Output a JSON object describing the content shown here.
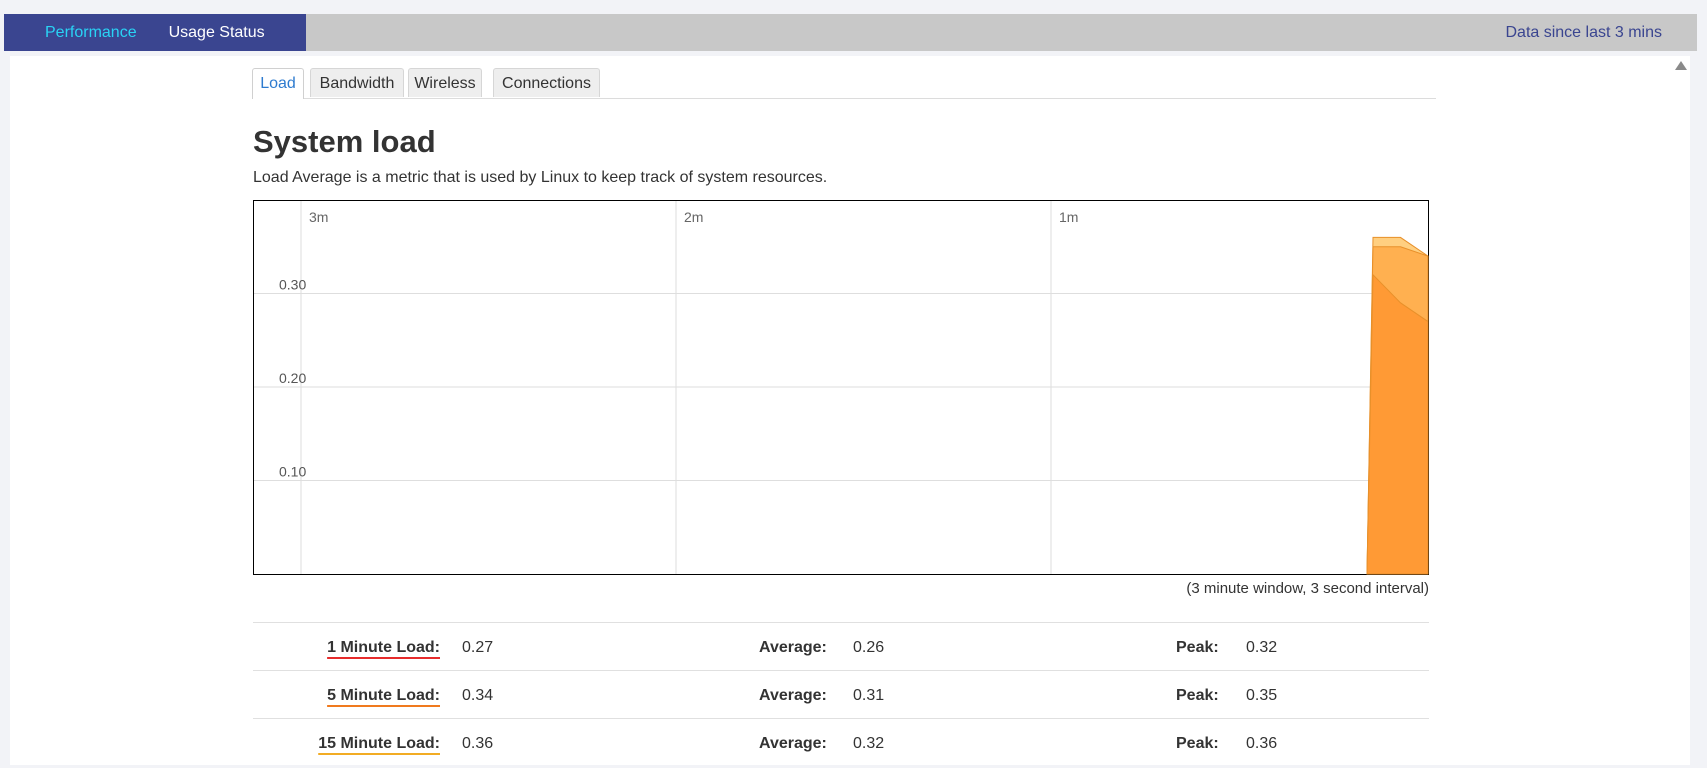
{
  "nav": {
    "items": [
      "Performance",
      "Usage Status"
    ],
    "since": "Data since last 3 mins"
  },
  "tabs": [
    "Load",
    "Bandwidth",
    "Wireless",
    "Connections"
  ],
  "page": {
    "title": "System load",
    "description": "Load Average is a metric that is used by Linux to keep track of system resources.",
    "window_note": "(3 minute window, 3 second interval)"
  },
  "chart_data": {
    "type": "area",
    "x_ticks": [
      "3m",
      "2m",
      "1m"
    ],
    "y_ticks": [
      "0.10",
      "0.20",
      "0.30"
    ],
    "ylim": [
      0,
      0.4
    ],
    "grid": true,
    "series": [
      {
        "name": "15 Minute Load",
        "color": "#ffcf80",
        "x": [
          -6,
          -3,
          0
        ],
        "values": [
          0.36,
          0.36,
          0.34
        ]
      },
      {
        "name": "5 Minute Load",
        "color": "#ffb050",
        "x": [
          -6,
          -3,
          0
        ],
        "values": [
          0.35,
          0.35,
          0.34
        ]
      },
      {
        "name": "1 Minute Load",
        "color": "#ff9a35",
        "x": [
          -6,
          -3,
          0
        ],
        "values": [
          0.32,
          0.29,
          0.27
        ]
      }
    ]
  },
  "stats": [
    {
      "label": "1 Minute Load:",
      "value": "0.27",
      "avg_label": "Average:",
      "avg": "0.26",
      "peak_label": "Peak:",
      "peak": "0.32",
      "color": "#e62b2b"
    },
    {
      "label": "5 Minute Load:",
      "value": "0.34",
      "avg_label": "Average:",
      "avg": "0.31",
      "peak_label": "Peak:",
      "peak": "0.35",
      "color": "#f07a1e"
    },
    {
      "label": "15 Minute Load:",
      "value": "0.36",
      "avg_label": "Average:",
      "avg": "0.32",
      "peak_label": "Peak:",
      "peak": "0.36",
      "color": "#f2ac24"
    }
  ]
}
